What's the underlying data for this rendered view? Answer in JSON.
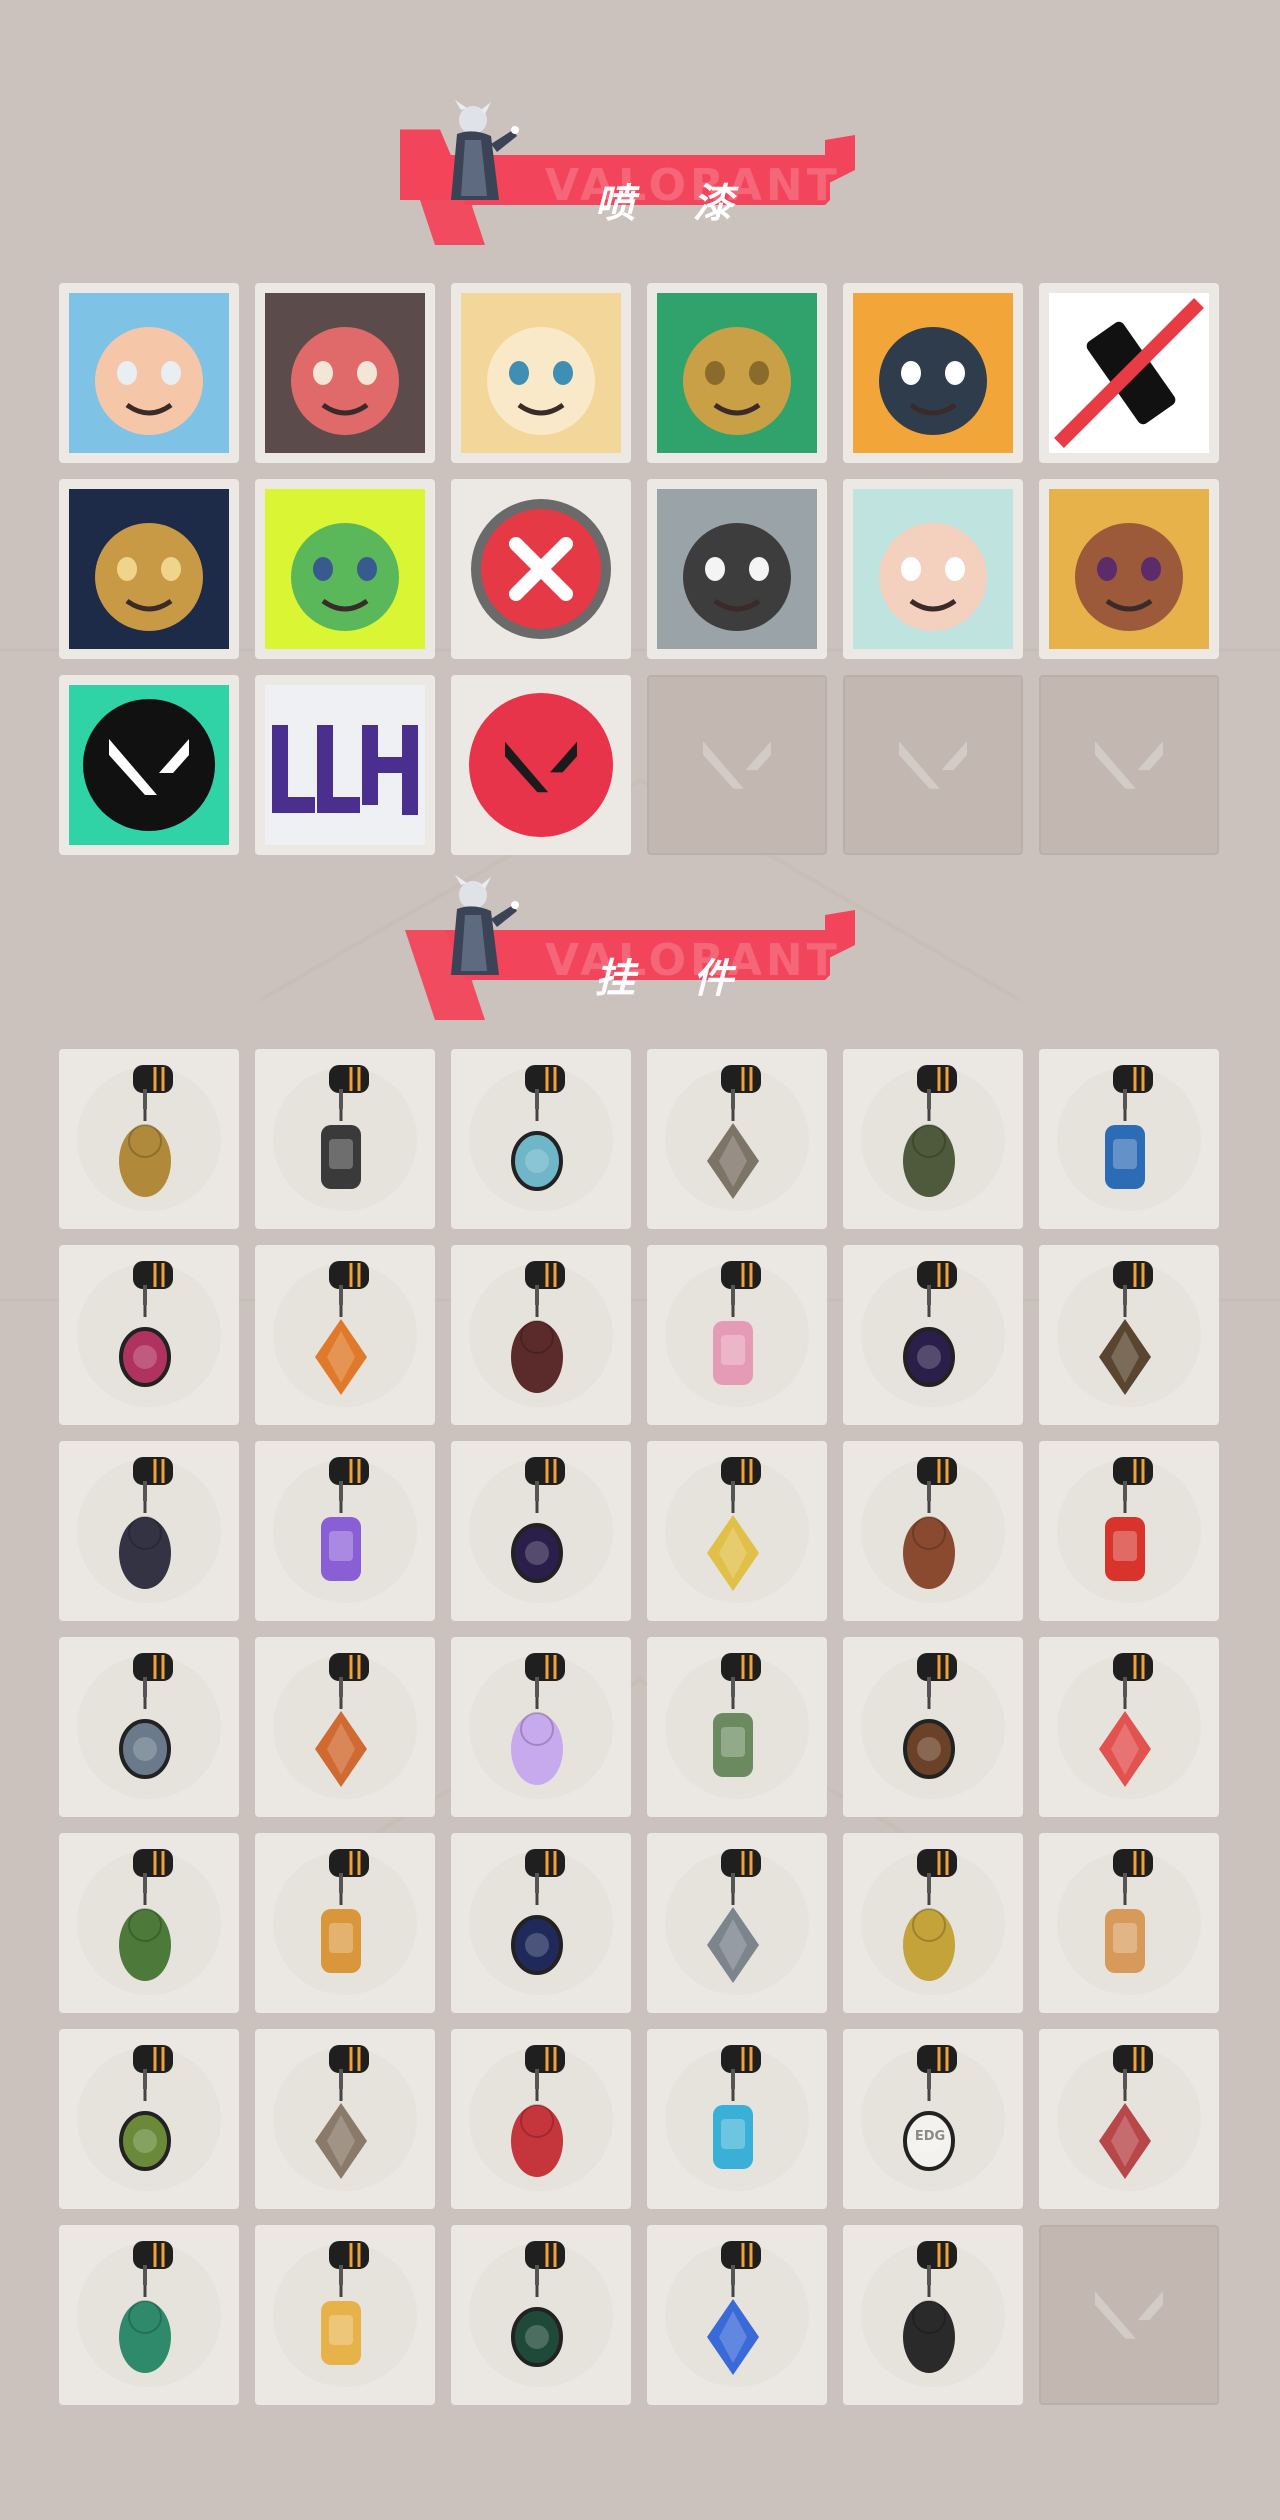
{
  "sections": {
    "sprays": {
      "title": "喷 漆",
      "watermark": "VALORANT"
    },
    "charms": {
      "title": "挂 件",
      "watermark": "VALORANT"
    }
  },
  "colors": {
    "background": "#cbc2bd",
    "banner_red": "#f2455b",
    "tile_light": "#ece9e4",
    "tile_empty": "#c2b8b1"
  },
  "sprays": [
    {
      "icon": "screaming-chibi-agent-icon",
      "owned": true
    },
    {
      "icon": "tongue-out-creature-icon",
      "owned": true
    },
    {
      "icon": "blonde-chibi-face-icon",
      "owned": true
    },
    {
      "icon": "gold-star-emblem-icon",
      "owned": true
    },
    {
      "icon": "duck-face-icon",
      "owned": true
    },
    {
      "icon": "spray-can-no-sign-icon",
      "owned": true
    },
    {
      "icon": "golden-cloud-waves-icon",
      "owned": true
    },
    {
      "icon": "green-slime-icon",
      "owned": true
    },
    {
      "icon": "red-x-button-icon",
      "owned": true
    },
    {
      "icon": "koi-fish-icon",
      "owned": true
    },
    {
      "icon": "pale-agent-face-icon",
      "owned": true
    },
    {
      "icon": "laughing-agent-icon",
      "owned": true
    },
    {
      "icon": "valorant-splatter-logo-icon",
      "owned": true
    },
    {
      "icon": "graffiti-tag-icon",
      "owned": true
    },
    {
      "icon": "red-valorant-logo-icon",
      "owned": true
    },
    {
      "icon": "valorant-logo-placeholder-icon",
      "owned": false
    },
    {
      "icon": "valorant-logo-placeholder-icon",
      "owned": false
    },
    {
      "icon": "valorant-logo-placeholder-icon",
      "owned": false
    }
  ],
  "charms": [
    {
      "icon": "gold-cat-charm-icon",
      "owned": true
    },
    {
      "icon": "robot-drone-charm-icon",
      "owned": true
    },
    {
      "icon": "basket-charm-icon",
      "owned": true
    },
    {
      "icon": "raccoon-charm-icon",
      "owned": true
    },
    {
      "icon": "pouch-charm-icon",
      "owned": true
    },
    {
      "icon": "blue-canister-charm-icon",
      "owned": true
    },
    {
      "icon": "spiked-blade-charm-icon",
      "owned": true
    },
    {
      "icon": "orange-creature-charm-icon",
      "owned": true
    },
    {
      "icon": "braided-cord-charm-icon",
      "owned": true
    },
    {
      "icon": "cupcake-charm-icon",
      "owned": true
    },
    {
      "icon": "ep9-medal-charm-icon",
      "owned": true
    },
    {
      "icon": "pistol-charm-icon",
      "owned": true
    },
    {
      "icon": "dragon-charm-icon",
      "owned": true
    },
    {
      "icon": "lava-lamp-charm-icon",
      "owned": true
    },
    {
      "icon": "ep9-medal-charm-icon",
      "owned": true
    },
    {
      "icon": "banana-charm-icon",
      "owned": true
    },
    {
      "icon": "popsicle-charm-icon",
      "owned": true
    },
    {
      "icon": "fruit-skewer-charm-icon",
      "owned": true
    },
    {
      "icon": "agent-figure-charm-icon",
      "owned": true
    },
    {
      "icon": "hot-air-balloon-charm-icon",
      "owned": true
    },
    {
      "icon": "crystal-pet-charm-icon",
      "owned": true
    },
    {
      "icon": "coffee-machine-charm-icon",
      "owned": true
    },
    {
      "icon": "lute-charm-icon",
      "owned": true
    },
    {
      "icon": "watermelon-charm-icon",
      "owned": true
    },
    {
      "icon": "soda-can-charm-icon",
      "owned": true
    },
    {
      "icon": "beehive-charm-icon",
      "owned": true
    },
    {
      "icon": "ep9-medal-charm-icon",
      "owned": true
    },
    {
      "icon": "droplet-charm-icon",
      "owned": true
    },
    {
      "icon": "golden-robot-charm-icon",
      "owned": true
    },
    {
      "icon": "corgi-charm-icon",
      "owned": true
    },
    {
      "icon": "leaf-sprout-charm-icon",
      "owned": true
    },
    {
      "icon": "raccoon-figure-charm-icon",
      "owned": true
    },
    {
      "icon": "mech-robot-charm-icon",
      "owned": true
    },
    {
      "icon": "blue-blade-charm-icon",
      "owned": true
    },
    {
      "icon": "edg-team-charm-icon",
      "owned": true,
      "label": "EDG"
    },
    {
      "icon": "octopus-charm-icon",
      "owned": true
    },
    {
      "icon": "gem-star-charm-icon",
      "owned": true
    },
    {
      "icon": "sun-cloud-charm-icon",
      "owned": true
    },
    {
      "icon": "ep9-medal-charm-icon",
      "owned": true
    },
    {
      "icon": "ufo-charm-icon",
      "owned": true
    },
    {
      "icon": "valorant-medal-charm-icon",
      "owned": true
    },
    {
      "icon": "valorant-logo-placeholder-icon",
      "owned": false
    }
  ]
}
